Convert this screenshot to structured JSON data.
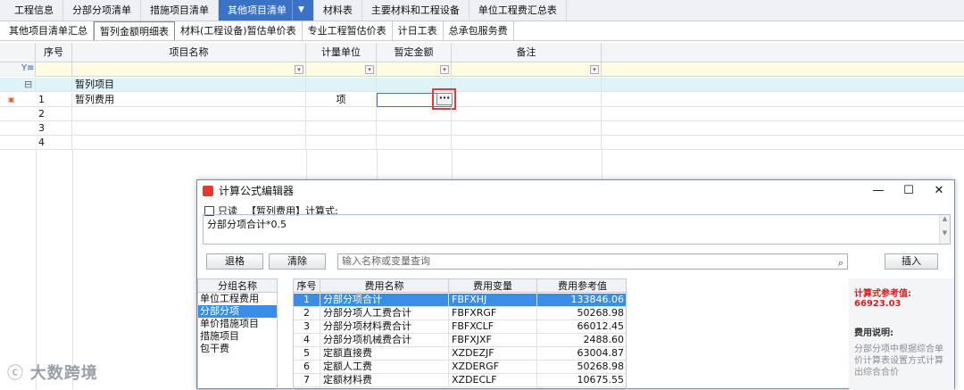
{
  "top_tabs": [
    "工程信息",
    "分部分项清单",
    "措施项目清单",
    "其他项目清单",
    "材料表",
    "主要材料和工程设备",
    "单位工程费汇总表"
  ],
  "active_top_tab": "其他项目清单",
  "active_top_tab_dropdown": "▼",
  "sub_tabs": [
    "其他项目清单汇总",
    "暂列金额明细表",
    "材料(工程设备)暂估单价表",
    "专业工程暂估价表",
    "计日工表",
    "总承包服务费"
  ],
  "grid": {
    "columns": [
      "序号",
      "项目名称",
      "计量单位",
      "暂定金额",
      "备注"
    ],
    "group_row": {
      "toggle": "⊟",
      "name": "暂列项目"
    },
    "rows": [
      {
        "no": "1",
        "name": "暂列费用",
        "unit": "项",
        "amount": "",
        "note": ""
      },
      {
        "no": "2",
        "name": "",
        "unit": "",
        "amount": "",
        "note": ""
      },
      {
        "no": "3",
        "name": "",
        "unit": "",
        "amount": "",
        "note": ""
      },
      {
        "no": "4",
        "name": "",
        "unit": "",
        "amount": "",
        "note": ""
      }
    ],
    "ellipsis": "···"
  },
  "dialog": {
    "title": "计算公式编辑器",
    "readonly_label": "只读",
    "formula_caption": "【暂列费用】计算式:",
    "formula": "分部分项合计*0.5",
    "backspace_label": "退格",
    "clear_label": "清除",
    "search_placeholder": "输入名称或变量查询",
    "insert_label": "插入",
    "group_header": "分组名称",
    "groups": [
      "单位工程费用",
      "分部分项",
      "单价措施项目",
      "措施项目",
      "包干费"
    ],
    "selected_group": "分部分项",
    "fee_columns": [
      "序号",
      "费用名称",
      "费用变量",
      "费用参考值"
    ],
    "fees": [
      {
        "no": "1",
        "name": "分部分项合计",
        "var": "FBFXHJ",
        "ref": "133846.06"
      },
      {
        "no": "2",
        "name": "分部分项人工费合计",
        "var": "FBFXRGF",
        "ref": "50268.98"
      },
      {
        "no": "3",
        "name": "分部分项材料费合计",
        "var": "FBFXCLF",
        "ref": "66012.45"
      },
      {
        "no": "4",
        "name": "分部分项机械费合计",
        "var": "FBFXJXF",
        "ref": "2488.60"
      },
      {
        "no": "5",
        "name": "定额直接费",
        "var": "XZDEZJF",
        "ref": "63004.87"
      },
      {
        "no": "6",
        "name": "定额人工费",
        "var": "XZDERGF",
        "ref": "50268.98"
      },
      {
        "no": "7",
        "name": "定额材料费",
        "var": "XZDECLF",
        "ref": "10675.55"
      }
    ],
    "ref_value_label": "计算式参考值:",
    "ref_value": "66923.03",
    "desc_label": "费用说明:",
    "desc": "分部分项中根据综合单价计算表设置方式计算出综合合价"
  },
  "watermark": "大数跨境"
}
